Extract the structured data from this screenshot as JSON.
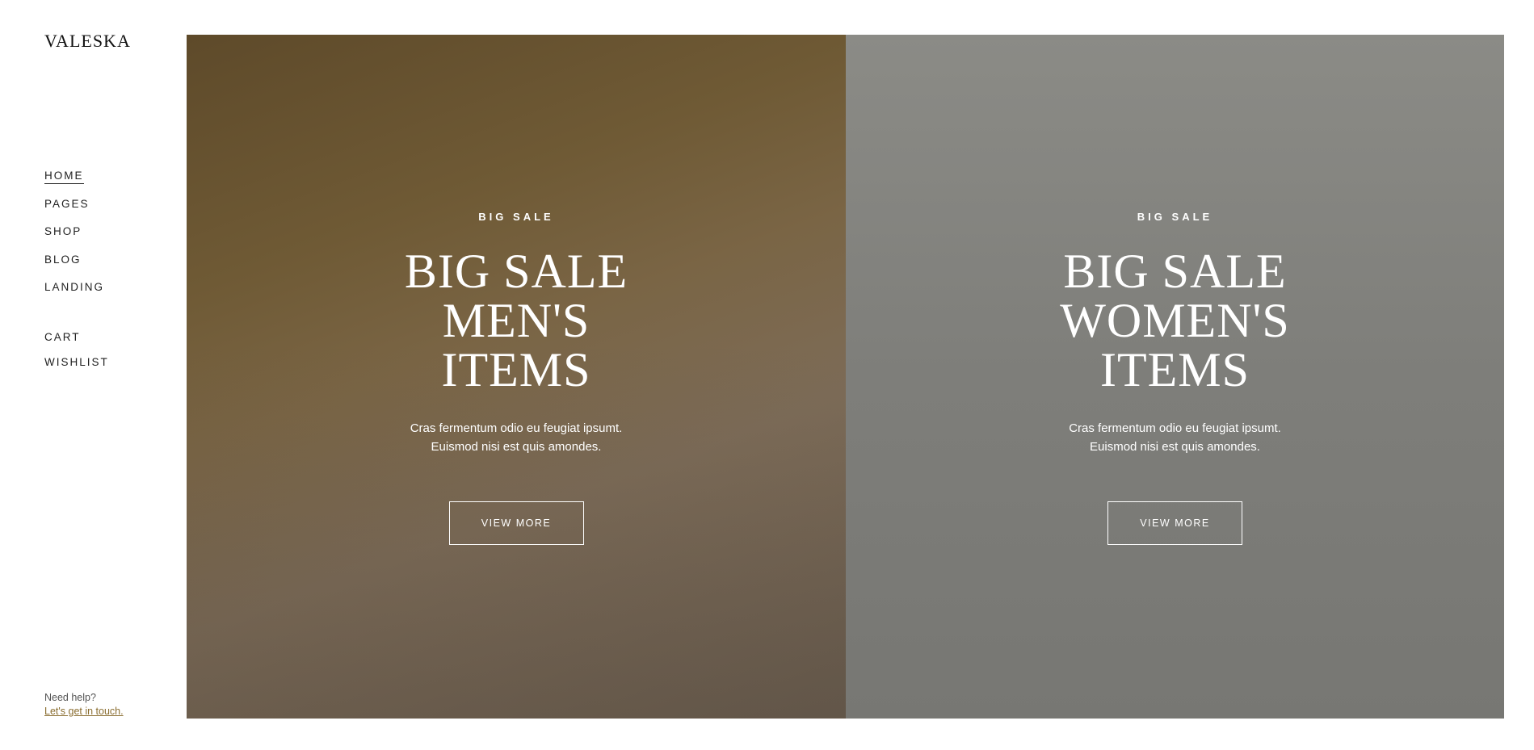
{
  "brand": "VALESKA",
  "nav": {
    "items": [
      "HOME",
      "PAGES",
      "SHOP",
      "BLOG",
      "LANDING"
    ],
    "secondary": [
      "CART",
      "WISHLIST"
    ]
  },
  "help": {
    "question": "Need help?",
    "link": "Let's get in touch."
  },
  "banners": [
    {
      "kicker": "BIG SALE",
      "title_lines": [
        "BIG SALE",
        "MEN'S",
        "ITEMS"
      ],
      "desc_lines": [
        "Cras fermentum odio eu feugiat ipsumt.",
        "Euismod nisi est quis amondes."
      ],
      "button": "VIEW MORE"
    },
    {
      "kicker": "BIG SALE",
      "title_lines": [
        "BIG SALE",
        "WOMEN'S",
        "ITEMS"
      ],
      "desc_lines": [
        "Cras fermentum odio eu feugiat ipsumt.",
        "Euismod nisi est quis amondes."
      ],
      "button": "VIEW MORE"
    }
  ]
}
